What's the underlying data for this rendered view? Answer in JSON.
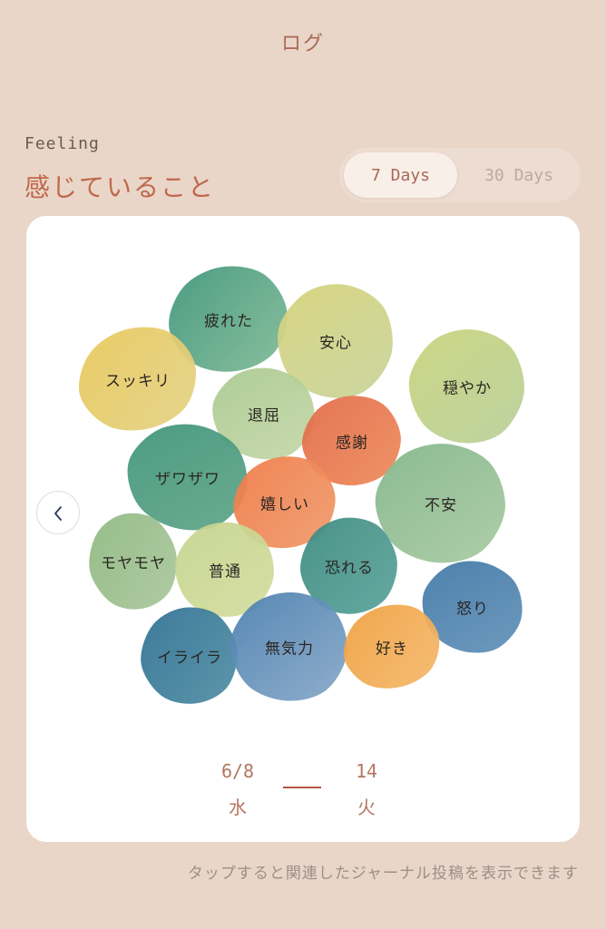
{
  "nav": {
    "title": "ログ"
  },
  "section": {
    "subtitle": "Feeling",
    "title": "感じていること"
  },
  "range_toggle": {
    "option_7": "7 Days",
    "option_30": "30 Days",
    "selected": "7 Days"
  },
  "bubbles": [
    {
      "label": "疲れた",
      "color_a": "#3f957a",
      "color_b": "#7fba95"
    },
    {
      "label": "安心",
      "color_a": "#d6d37a",
      "color_b": "#c7d39a"
    },
    {
      "label": "スッキリ",
      "color_a": "#e8c85a",
      "color_b": "#e3d184"
    },
    {
      "label": "穏やか",
      "color_a": "#c9d37a",
      "color_b": "#b8cf9a"
    },
    {
      "label": "退屈",
      "color_a": "#a9c98e",
      "color_b": "#c4d7a8"
    },
    {
      "label": "感謝",
      "color_a": "#e26a48",
      "color_b": "#ee8a5a"
    },
    {
      "label": "ザワザワ",
      "color_a": "#3e9479",
      "color_b": "#5fa588"
    },
    {
      "label": "嬉しい",
      "color_a": "#ee7a48",
      "color_b": "#f09a6a"
    },
    {
      "label": "不安",
      "color_a": "#82b688",
      "color_b": "#a8c9a2"
    },
    {
      "label": "モヤモヤ",
      "color_a": "#8eb87f",
      "color_b": "#a9c79c"
    },
    {
      "label": "普通",
      "color_a": "#c4d48c",
      "color_b": "#d3dc9e"
    },
    {
      "label": "恐れる",
      "color_a": "#3c8a80",
      "color_b": "#5aa39a"
    },
    {
      "label": "怒り",
      "color_a": "#3f77a6",
      "color_b": "#6392b8"
    },
    {
      "label": "イライラ",
      "color_a": "#2f6f93",
      "color_b": "#4f8ea3"
    },
    {
      "label": "無気力",
      "color_a": "#4a7fae",
      "color_b": "#86a7c8"
    },
    {
      "label": "好き",
      "color_a": "#f0a040",
      "color_b": "#f4b86a"
    }
  ],
  "date_range": {
    "start_date": "6/8",
    "start_day": "水",
    "end_date": "14",
    "end_day": "火"
  },
  "footer": {
    "hint": "タップすると関連したジャーナル投稿を表示できます"
  },
  "icons": {
    "prev": "chevron-left-icon"
  }
}
